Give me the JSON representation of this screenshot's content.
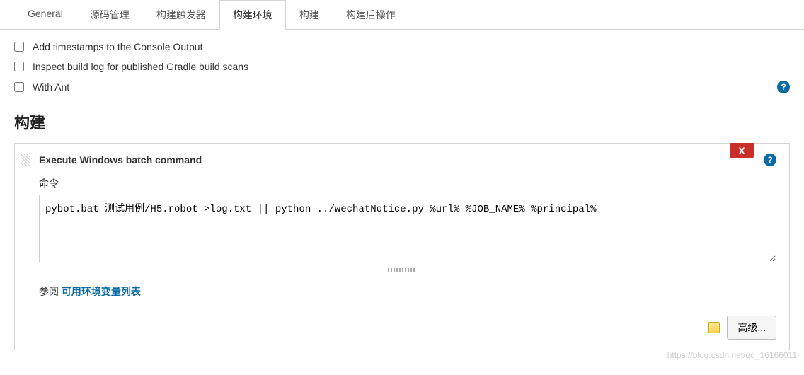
{
  "tabs": {
    "general": "General",
    "scm": "源码管理",
    "triggers": "构建触发器",
    "env": "构建环境",
    "build": "构建",
    "post": "构建后操作"
  },
  "env_options": {
    "timestamps": "Add timestamps to the Console Output",
    "gradle_scans": "Inspect build log for published Gradle build scans",
    "with_ant": "With Ant"
  },
  "section_build_title": "构建",
  "build_step": {
    "title": "Execute Windows batch command",
    "delete_label": "X",
    "command_label": "命令",
    "command_value": "pybot.bat 测试用例/H5.robot >log.txt || python ../wechatNotice.py %url% %JOB_NAME% %principal%",
    "ref_prefix": "参阅 ",
    "ref_link_text": "可用环境变量列表",
    "advanced_label": "高级..."
  },
  "help_glyph": "?",
  "watermark": "https://blog.csdn.net/qq_16166011"
}
